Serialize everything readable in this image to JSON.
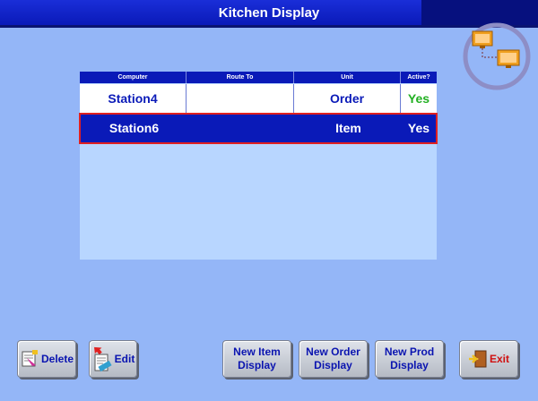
{
  "window": {
    "title": "Kitchen Display"
  },
  "table": {
    "columns": [
      "Computer",
      "Route To",
      "Unit",
      "Active?"
    ],
    "rows": [
      {
        "computer": "Station4",
        "route_to": "",
        "unit": "Order",
        "active": "Yes",
        "selected": false
      },
      {
        "computer": "Station6",
        "route_to": "",
        "unit": "Item",
        "active": "Yes",
        "selected": true
      }
    ]
  },
  "buttons": {
    "delete": "Delete",
    "edit": "Edit",
    "new_item_line1": "New Item",
    "new_item_line2": "Display",
    "new_order_line1": "New Order",
    "new_order_line2": "Display",
    "new_prod_line1": "New Prod",
    "new_prod_line2": "Display",
    "exit": "Exit"
  },
  "colors": {
    "background": "#94b6f7",
    "title_bar": "#0a1ab8",
    "grid_body": "#b8d6ff",
    "selection_border": "#e02020",
    "active_yes": "#22b022"
  },
  "icons": [
    "network-computers-icon",
    "delete-icon",
    "edit-icon",
    "exit-icon"
  ]
}
